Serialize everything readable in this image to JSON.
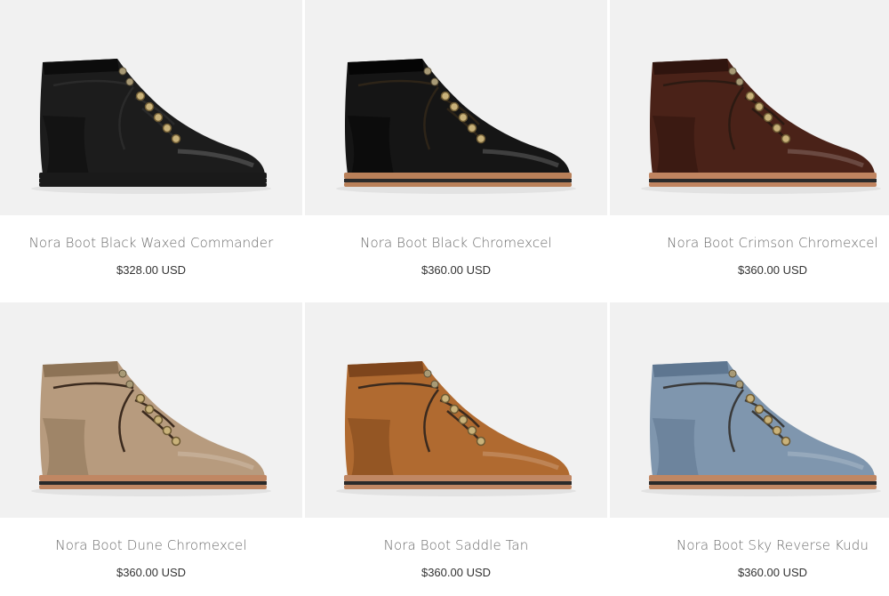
{
  "products": [
    {
      "title": "Nora Boot Black Waxed Commander",
      "price": "$328.00 USD",
      "upper": "#1c1c1c",
      "upper_shade": "#0c0c0c",
      "lace": "#2a2a2a",
      "welt": "#1a1a1a",
      "stripe": "#1a1a1a"
    },
    {
      "title": "Nora Boot Black Chromexcel",
      "price": "$360.00 USD",
      "upper": "#151515",
      "upper_shade": "#050505",
      "lace": "#2d2418",
      "welt": "#b98059",
      "stripe": "#2a2a2a"
    },
    {
      "title": "Nora Boot Crimson Chromexcel",
      "price": "$360.00 USD",
      "upper": "#4a2218",
      "upper_shade": "#2f140e",
      "lace": "#2c1a12",
      "welt": "#c08460",
      "stripe": "#2a2a2a"
    },
    {
      "title": "Nora Boot Dune Chromexcel",
      "price": "$360.00 USD",
      "upper": "#b79b7e",
      "upper_shade": "#8d7356",
      "lace": "#3b2a1e",
      "welt": "#c08763",
      "stripe": "#2a2a2a"
    },
    {
      "title": "Nora Boot Saddle Tan",
      "price": "$360.00 USD",
      "upper": "#b06a30",
      "upper_shade": "#7e451c",
      "lace": "#3b2a1e",
      "welt": "#c08763",
      "stripe": "#2a2a2a"
    },
    {
      "title": "Nora Boot Sky Reverse Kudu",
      "price": "$360.00 USD",
      "upper": "#7f96ae",
      "upper_shade": "#5e7690",
      "lace": "#3a3a3a",
      "welt": "#c08763",
      "stripe": "#2a2a2a"
    }
  ]
}
